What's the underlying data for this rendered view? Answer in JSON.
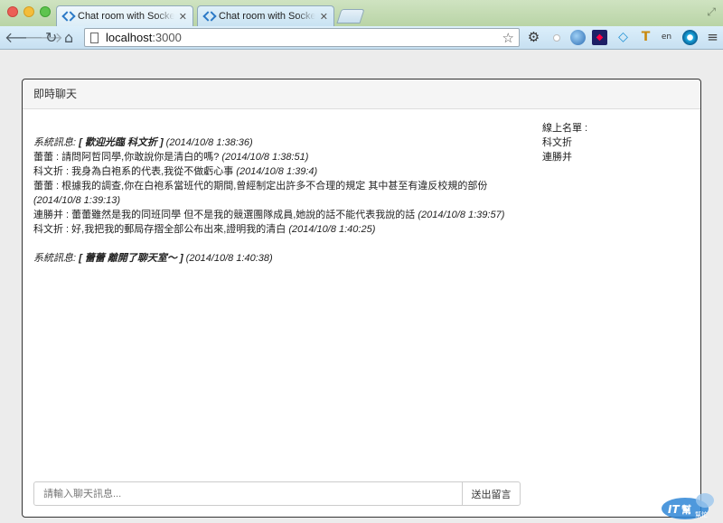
{
  "browser": {
    "tabs": [
      {
        "title": "Chat room with Socket.io a"
      },
      {
        "title": "Chat room with Socket.io a"
      }
    ],
    "url_host": "localhost",
    "url_port": ":3000"
  },
  "panel": {
    "title": "即時聊天"
  },
  "messages": [
    {
      "type": "system",
      "prefix": "系統訊息: ",
      "body": "[ 歡迎光臨 科文折 ]",
      "time": " (2014/10/8 1:38:36)"
    },
    {
      "type": "chat",
      "user": "蕾蕾",
      "sep": " : ",
      "body": "請問阿哲同學,你敢說你是清白的嗎?",
      "time": " (2014/10/8 1:38:51)"
    },
    {
      "type": "chat",
      "user": "科文折",
      "sep": " : ",
      "body": "我身為白袍系的代表,我從不做虧心事",
      "time": " (2014/10/8 1:39:4)"
    },
    {
      "type": "chat",
      "user": "蕾蕾",
      "sep": " : ",
      "body": "根據我的調查,你在白袍系當班代的期間,曾經制定出許多不合理的規定 其中甚至有違反校規的部份",
      "time": " (2014/10/8 1:39:13)"
    },
    {
      "type": "chat",
      "user": "連勝并",
      "sep": " : ",
      "body": "蕾蕾雖然是我的同班同學 但不是我的競選團隊成員,她說的話不能代表我說的話",
      "time": " (2014/10/8 1:39:57)"
    },
    {
      "type": "chat",
      "user": "科文折",
      "sep": " : ",
      "body": "好,我把我的郵局存摺全部公布出來,證明我的清白",
      "time": " (2014/10/8 1:40:25)"
    },
    {
      "type": "system",
      "prefix": "系統訊息: ",
      "body": "[ 蕾蕾 離開了聊天室～ ]",
      "time": " (2014/10/8 1:40:38)"
    }
  ],
  "online": {
    "label": "線上名單 :",
    "users": [
      "科文折",
      "連勝并"
    ]
  },
  "composer": {
    "placeholder": "請輸入聊天訊息...",
    "send_label": "送出留言"
  },
  "watermark": {
    "text": "IT幫幫忙"
  }
}
